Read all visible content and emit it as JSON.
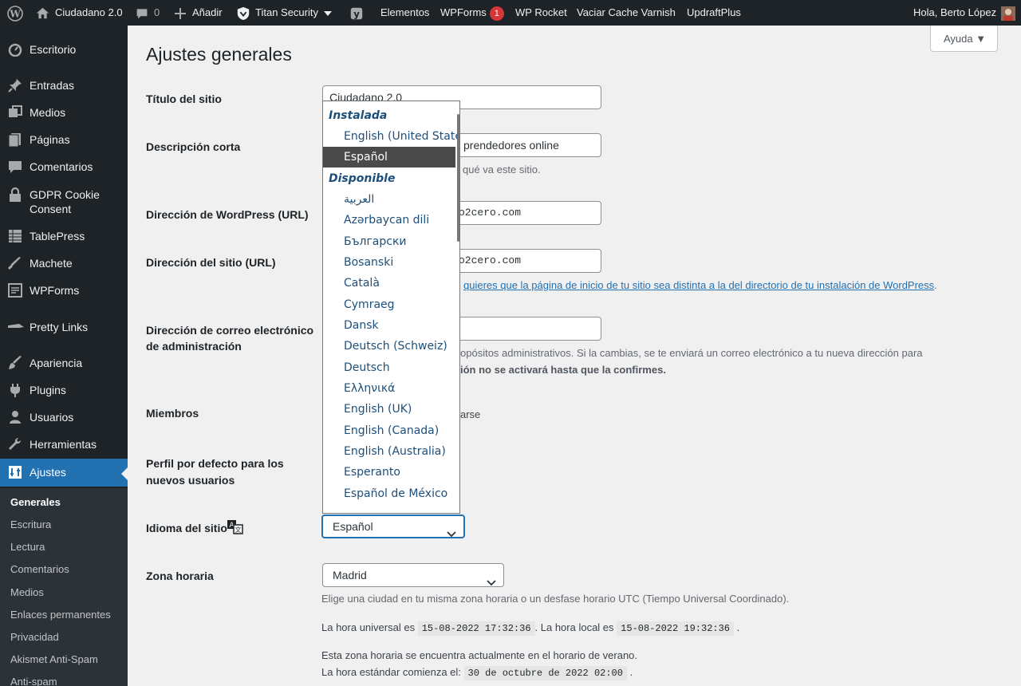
{
  "adminbar": {
    "site_name": "Ciudadano 2.0",
    "comments_count": "0",
    "add_new": "Añadir",
    "titan": "Titan Security",
    "elementos": "Elementos",
    "wpforms": "WPForms",
    "wpforms_badge": "1",
    "wprocket": "WP Rocket",
    "varnish": "Vaciar Cache Varnish",
    "updraft": "UpdraftPlus",
    "greeting": "Hola, Berto López"
  },
  "sidebar": {
    "items": [
      {
        "label": "Escritorio",
        "icon": "dashboard-icon"
      },
      {
        "label": "Entradas",
        "icon": "pin-icon"
      },
      {
        "label": "Medios",
        "icon": "media-icon"
      },
      {
        "label": "Páginas",
        "icon": "pages-icon"
      },
      {
        "label": "Comentarios",
        "icon": "comments-icon"
      },
      {
        "label": "GDPR Cookie\nConsent",
        "icon": "lock-icon"
      },
      {
        "label": "TablePress",
        "icon": "table-icon"
      },
      {
        "label": "Machete",
        "icon": "machete-icon"
      },
      {
        "label": "WPForms",
        "icon": "forms-icon"
      },
      {
        "label": "Pretty Links",
        "icon": "pretty-links-icon"
      },
      {
        "label": "Apariencia",
        "icon": "brush-icon"
      },
      {
        "label": "Plugins",
        "icon": "plugin-icon"
      },
      {
        "label": "Usuarios",
        "icon": "users-icon"
      },
      {
        "label": "Herramientas",
        "icon": "tools-icon"
      },
      {
        "label": "Ajustes",
        "icon": "settings-icon"
      }
    ],
    "submenu": [
      "Generales",
      "Escritura",
      "Lectura",
      "Comentarios",
      "Medios",
      "Enlaces permanentes",
      "Privacidad",
      "Akismet Anti-Spam",
      "Anti-spam"
    ]
  },
  "page": {
    "title": "Ajustes generales",
    "help": "Ayuda"
  },
  "form": {
    "site_title_label": "Título del sitio",
    "site_title_value": "Ciudadano 2.0",
    "tagline_label": "Descripción corta",
    "tagline_value": "prendedores online",
    "tagline_desc": "qué va este sitio.",
    "wp_url_label": "Dirección de WordPress (URL)",
    "wp_url_value": "o2cero.com",
    "site_url_label": "Dirección del sitio (URL)",
    "site_url_value": "o2cero.com",
    "site_url_link": "quieres que la página de inicio de tu sitio sea distinta a la del directorio de tu instalación de WordPress",
    "email_label_1": "Dirección de correo electrónico",
    "email_label_2": "de administración",
    "email_desc_1": "opósitos administrativos. Si la cambias, se te enviará un correo electrónico a tu nueva dirección para",
    "email_desc_2": "ión no se activará hasta que la confirmes.",
    "members_label": "Miembros",
    "members_text": "arse",
    "role_label_1": "Perfil por defecto para los",
    "role_label_2": "nuevos usuarios",
    "language_label": "Idioma del sitio",
    "language_value": "Español",
    "timezone_label": "Zona horaria",
    "timezone_value": "Madrid",
    "timezone_desc": "Elige una ciudad en tu misma zona horaria o un desfase horario UTC (Tiempo Universal Coordinado).",
    "utc_prefix": "La hora universal es",
    "utc_time": "15-08-2022 17:32:36",
    "local_prefix": ". La hora local es",
    "local_time": "15-08-2022 19:32:36",
    "dst_line": "Esta zona horaria se encuentra actualmente en el horario de verano.",
    "std_prefix": "La hora estándar comienza el:",
    "std_time": "30 de octubre de 2022 02:00"
  },
  "language_dropdown": {
    "group_installed": "Instalada",
    "installed": [
      "English (United States)",
      "Español"
    ],
    "selected_index": 1,
    "group_available": "Disponible",
    "available": [
      "العربية",
      "Azərbaycan dili",
      "Български",
      "Bosanski",
      "Català",
      "Cymraeg",
      "Dansk",
      "Deutsch (Schweiz)",
      "Deutsch",
      "Ελληνικά",
      "English (UK)",
      "English (Canada)",
      "English (Australia)",
      "Esperanto",
      "Español de México"
    ]
  }
}
